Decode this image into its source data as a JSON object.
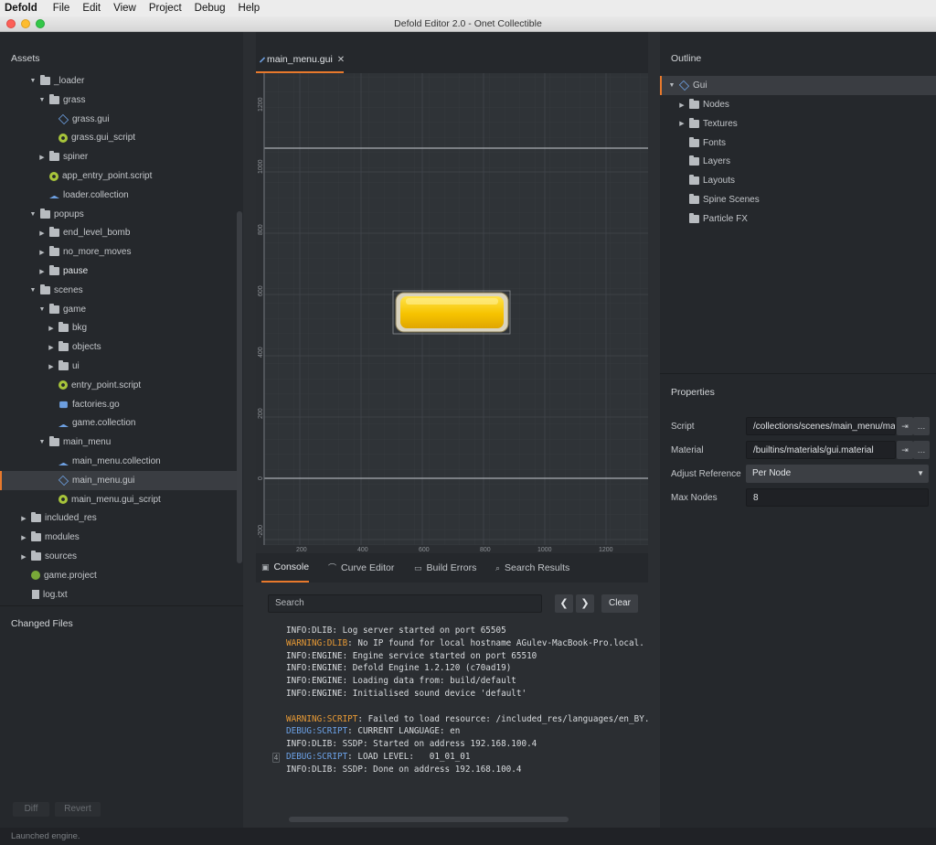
{
  "menubar": {
    "app": "Defold",
    "items": [
      "File",
      "Edit",
      "View",
      "Project",
      "Debug",
      "Help"
    ]
  },
  "window": {
    "title": "Defold Editor 2.0 - Onet Collectible"
  },
  "assets": {
    "title": "Assets",
    "tree": [
      {
        "label": "_loader",
        "icon": "folder-icon",
        "arrow": "▼",
        "indent": 0
      },
      {
        "label": "grass",
        "icon": "folder-icon",
        "arrow": "▼",
        "indent": 1
      },
      {
        "label": "grass.gui",
        "icon": "gui-icon",
        "arrow": "",
        "indent": 2
      },
      {
        "label": "grass.gui_script",
        "icon": "script-gear-icon",
        "arrow": "",
        "indent": 2
      },
      {
        "label": "spiner",
        "icon": "folder-icon",
        "arrow": "▶",
        "indent": 1
      },
      {
        "label": "app_entry_point.script",
        "icon": "script-gear-icon",
        "arrow": "",
        "indent": 1
      },
      {
        "label": "loader.collection",
        "icon": "collection-icon",
        "arrow": "",
        "indent": 1
      },
      {
        "label": "popups",
        "icon": "folder-icon",
        "arrow": "▼",
        "indent": 0
      },
      {
        "label": "end_level_bomb",
        "icon": "folder-icon",
        "arrow": "▶",
        "indent": 1
      },
      {
        "label": "no_more_moves",
        "icon": "folder-icon",
        "arrow": "▶",
        "indent": 1
      },
      {
        "label": "pause",
        "icon": "folder-icon",
        "arrow": "▶",
        "indent": 1,
        "bold": true
      },
      {
        "label": "scenes",
        "icon": "folder-icon",
        "arrow": "▼",
        "indent": 0
      },
      {
        "label": "game",
        "icon": "folder-icon",
        "arrow": "▼",
        "indent": 1
      },
      {
        "label": "bkg",
        "icon": "folder-icon",
        "arrow": "▶",
        "indent": 2
      },
      {
        "label": "objects",
        "icon": "folder-icon",
        "arrow": "▶",
        "indent": 2
      },
      {
        "label": "ui",
        "icon": "folder-icon",
        "arrow": "▶",
        "indent": 2
      },
      {
        "label": "entry_point.script",
        "icon": "script-gear-icon",
        "arrow": "",
        "indent": 2
      },
      {
        "label": "factories.go",
        "icon": "gameobject-icon",
        "arrow": "",
        "indent": 2
      },
      {
        "label": "game.collection",
        "icon": "collection-icon",
        "arrow": "",
        "indent": 2
      },
      {
        "label": "main_menu",
        "icon": "folder-icon",
        "arrow": "▼",
        "indent": 1
      },
      {
        "label": "main_menu.collection",
        "icon": "collection-icon",
        "arrow": "",
        "indent": 2
      },
      {
        "label": "main_menu.gui",
        "icon": "gui-icon",
        "arrow": "",
        "indent": 2,
        "selected": true
      },
      {
        "label": "main_menu.gui_script",
        "icon": "script-gear-icon",
        "arrow": "",
        "indent": 2
      },
      {
        "label": "included_res",
        "icon": "folder-icon",
        "arrow": "▶",
        "indent": -1
      },
      {
        "label": "modules",
        "icon": "folder-icon",
        "arrow": "▶",
        "indent": -1
      },
      {
        "label": "sources",
        "icon": "folder-icon",
        "arrow": "▶",
        "indent": -1
      },
      {
        "label": "game.project",
        "icon": "project-icon",
        "arrow": "",
        "indent": -1
      },
      {
        "label": "log.txt",
        "icon": "file-icon",
        "arrow": "",
        "indent": -1
      }
    ]
  },
  "changed_files": {
    "title": "Changed Files",
    "diff_label": "Diff",
    "revert_label": "Revert"
  },
  "editor": {
    "tab_label": "main_menu.gui",
    "ruler_x": [
      "200",
      "400",
      "600",
      "800",
      "1000",
      "1200"
    ],
    "ruler_y": [
      "1200",
      "1000",
      "800",
      "600",
      "400",
      "200",
      "0",
      "-200"
    ]
  },
  "bottom_tabs": {
    "console": "Console",
    "curve_editor": "Curve Editor",
    "build_errors": "Build Errors",
    "search_results": "Search Results"
  },
  "console": {
    "search_placeholder": "Search",
    "prev": "❮",
    "next": "❯",
    "clear_label": "Clear",
    "repeat_count": "4",
    "lines": [
      {
        "level": "INFO:DLIB",
        "type": "info",
        "text": ": Log server started on port 65505"
      },
      {
        "level": "WARNING:DLIB",
        "type": "warn",
        "text": ": No IP found for local hostname AGulev-MacBook-Pro.local. Fa"
      },
      {
        "level": "INFO:ENGINE",
        "type": "info",
        "text": ": Engine service started on port 65510"
      },
      {
        "level": "INFO:ENGINE",
        "type": "info",
        "text": ": Defold Engine 1.2.120 (c70ad19)"
      },
      {
        "level": "INFO:ENGINE",
        "type": "info",
        "text": ": Loading data from: build/default"
      },
      {
        "level": "INFO:ENGINE",
        "type": "info",
        "text": ": Initialised sound device 'default'"
      },
      {
        "level": "",
        "type": "info",
        "text": ""
      },
      {
        "level": "WARNING:SCRIPT",
        "type": "warn",
        "text": ": Failed to load resource: /included_res/languages/en_BY.jso"
      },
      {
        "level": "DEBUG:SCRIPT",
        "type": "debug",
        "text": ": CURRENT LANGUAGE: en"
      },
      {
        "level": "INFO:DLIB",
        "type": "info",
        "text": ": SSDP: Started on address 192.168.100.4"
      },
      {
        "level": "DEBUG:SCRIPT",
        "type": "debug",
        "text": ": LOAD LEVEL:   01_01_01"
      },
      {
        "level": "INFO:DLIB",
        "type": "info",
        "text": ": SSDP: Done on address 192.168.100.4"
      }
    ]
  },
  "outline": {
    "title": "Outline",
    "root": "Gui",
    "children": [
      {
        "label": "Nodes",
        "arrow": "▶"
      },
      {
        "label": "Textures",
        "arrow": "▶"
      },
      {
        "label": "Fonts",
        "arrow": ""
      },
      {
        "label": "Layers",
        "arrow": ""
      },
      {
        "label": "Layouts",
        "arrow": ""
      },
      {
        "label": "Spine Scenes",
        "arrow": ""
      },
      {
        "label": "Particle FX",
        "arrow": ""
      }
    ]
  },
  "properties": {
    "title": "Properties",
    "script_label": "Script",
    "script_value": "/collections/scenes/main_menu/main_menu.gui_script",
    "material_label": "Material",
    "material_value": "/builtins/materials/gui.material",
    "adjust_label": "Adjust Reference",
    "adjust_value": "Per Node",
    "maxnodes_label": "Max Nodes",
    "maxnodes_value": "8",
    "goto_glyph": "⇥",
    "browse_glyph": "…"
  },
  "status": {
    "text": "Launched engine."
  },
  "colors": {
    "accent": "#e8792c",
    "button_yellow": "#f5c400"
  }
}
